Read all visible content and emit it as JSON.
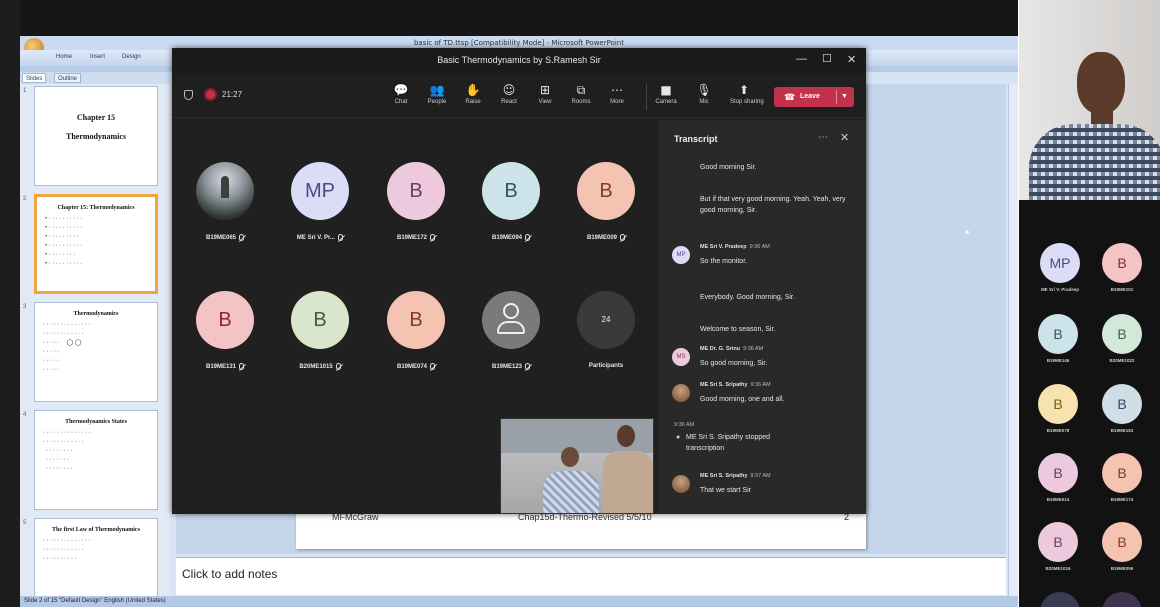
{
  "powerpoint": {
    "title": "basic of TD.ttsp [Compatibility Mode] - Microsoft PowerPoint",
    "ribbon_tabs": [
      "Home",
      "Insert",
      "Design"
    ],
    "pane_tabs": [
      "Slides",
      "Outline"
    ],
    "thumbnails": [
      {
        "title": "Chapter 15",
        "subtitle": "Thermodynamics"
      },
      {
        "title": "Chapter 15: Thermodynamics"
      },
      {
        "title": "Thermodynamics"
      },
      {
        "title": "Thermodynamics States"
      },
      {
        "title": "The first Law of Thermodynamics"
      }
    ],
    "slide_footer": {
      "left": "MFMcGraw",
      "center": "Chap15d-Thermo-Revised 5/5/10",
      "right": "2"
    },
    "notes_placeholder": "Click to add notes",
    "status_bar": "Slide 2 of 15   \"Default Design\"   English (United States)"
  },
  "teams": {
    "window_title": "Basic Thermodynamics by S.Ramesh Sir",
    "timer": "21:27",
    "toolbar": [
      {
        "icon": "chat-icon",
        "glyph": "💬",
        "label": "Chat"
      },
      {
        "icon": "people-icon",
        "glyph": "👥",
        "label": "People"
      },
      {
        "icon": "raise-hand-icon",
        "glyph": "✋",
        "label": "Raise"
      },
      {
        "icon": "react-icon",
        "glyph": "☺",
        "label": "React"
      },
      {
        "icon": "view-icon",
        "glyph": "⊞",
        "label": "View"
      },
      {
        "icon": "rooms-icon",
        "glyph": "⧉",
        "label": "Rooms"
      },
      {
        "icon": "more-icon",
        "glyph": "⋯",
        "label": "More"
      },
      {
        "icon": "camera-icon",
        "glyph": "■",
        "label": "Camera"
      },
      {
        "icon": "mic-icon",
        "glyph": "🎙",
        "label": "Mic"
      },
      {
        "icon": "share-icon",
        "glyph": "⬆",
        "label": "Stop sharing"
      }
    ],
    "leave_label": "Leave",
    "participants": [
      {
        "name": "B19ME065",
        "initials": "",
        "photo": true
      },
      {
        "name": "ME Sri V. Pr...",
        "initials": "MP",
        "bg": "#dcdcf6",
        "fg": "#4a4a8a"
      },
      {
        "name": "B19ME172",
        "initials": "B",
        "bg": "#ecc9dc",
        "fg": "#7a3a5a"
      },
      {
        "name": "B19ME094",
        "initials": "B",
        "bg": "#cde3ea",
        "fg": "#2f5666"
      },
      {
        "name": "B19ME009",
        "initials": "B",
        "bg": "#f4c3b1",
        "fg": "#8a3a22"
      },
      {
        "name": "B19ME131",
        "initials": "B",
        "bg": "#f4c4c4",
        "fg": "#8a2a2a"
      },
      {
        "name": "B20ME1015",
        "initials": "B",
        "bg": "#d9e6cd",
        "fg": "#44602c"
      },
      {
        "name": "B19ME074",
        "initials": "B",
        "bg": "#f4c3b1",
        "fg": "#8a3a22"
      },
      {
        "name": "B19ME123",
        "initials": "",
        "generic": true
      },
      {
        "name": "Participants",
        "initials": "24",
        "count": true
      }
    ],
    "transcript": {
      "title": "Transcript",
      "entries": [
        {
          "text": "Good morning Sir."
        },
        {
          "text": "But if that very good morning. Yeah. Yeah, very good morning, Sir."
        },
        {
          "speaker": "ME Sri V. Pradeep",
          "time": "9:36 AM",
          "avatar": "MP",
          "text": "So the monitor."
        },
        {
          "text": "Everybody. Good morning, Sir."
        },
        {
          "text": "Welcome to season, Sir."
        },
        {
          "speaker": "ME Dr. G. Srinu",
          "time": "9:36 AM",
          "avatar": "MS",
          "text": "So good morning, Sir."
        },
        {
          "speaker": "ME Sri S. Sripathy",
          "time": "9:36 AM",
          "avatar": "photo",
          "text": "Good morning, one and all."
        },
        {
          "time_only": "9:36 AM",
          "system": "ME Sri S. Sripathy stopped transcription"
        },
        {
          "speaker": "ME Sri S. Sripathy",
          "time": "9:37 AM",
          "avatar": "photo",
          "text": "That we start Sir"
        }
      ]
    }
  },
  "side_gallery": [
    {
      "name": "ME Sri V. Pradeep",
      "initials": "MP",
      "bg": "#dcdcf6",
      "fg": "#4a4a8a"
    },
    {
      "name": "B19ME101",
      "initials": "B",
      "bg": "#f4c4c4",
      "fg": "#8a2a2a"
    },
    {
      "name": "B19ME146",
      "initials": "B",
      "bg": "#cde3ea",
      "fg": "#2f5666"
    },
    {
      "name": "B20ME1022",
      "initials": "B",
      "bg": "#d2e8d8",
      "fg": "#2f6a44"
    },
    {
      "name": "B19ME078",
      "initials": "B",
      "bg": "#f6e3b0",
      "fg": "#7a5a14"
    },
    {
      "name": "B19ME153",
      "initials": "B",
      "bg": "#cfdde6",
      "fg": "#2f4a66"
    },
    {
      "name": "B19ME014",
      "initials": "B",
      "bg": "#ecc9dc",
      "fg": "#7a3a5a"
    },
    {
      "name": "B19ME174",
      "initials": "B",
      "bg": "#f4c3b1",
      "fg": "#8a3a22"
    },
    {
      "name": "B20ME1016",
      "initials": "B",
      "bg": "#ecc9dc",
      "fg": "#7a3a5a"
    },
    {
      "name": "B19ME059",
      "initials": "B",
      "bg": "#f4c3b1",
      "fg": "#8a3a22"
    }
  ]
}
